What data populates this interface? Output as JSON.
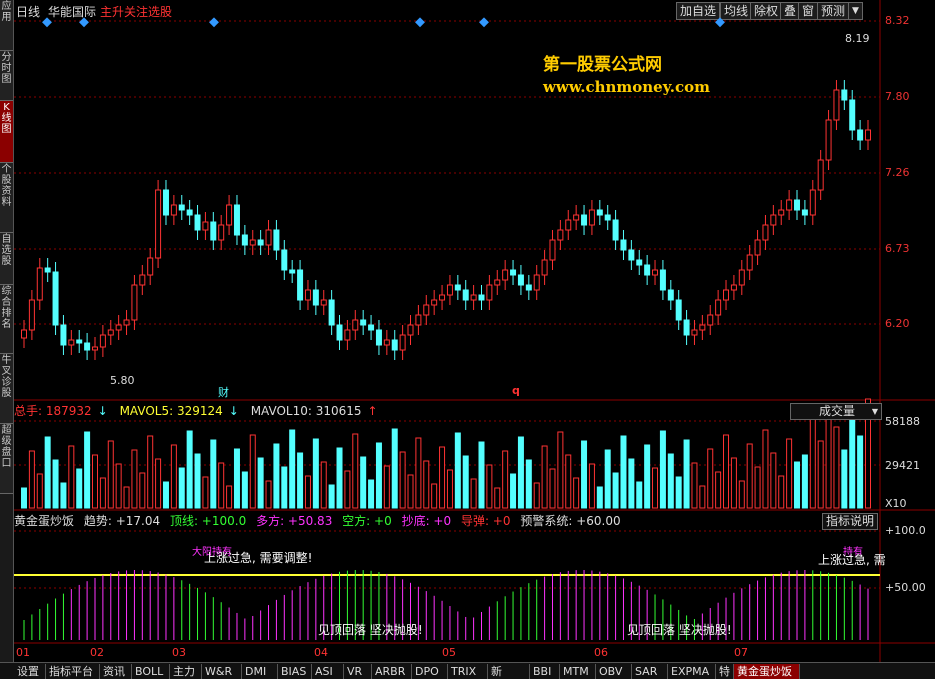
{
  "header": {
    "period": "日线",
    "stock_name": "华能国际",
    "formula_name": "主升关注选股",
    "buttons": [
      "加自选",
      "均线",
      "除权",
      "叠",
      "窗",
      "预测"
    ],
    "menu_arrow": "▼"
  },
  "sidebar": {
    "tabs": [
      "应用",
      "分时图",
      "K线图",
      "个股资料",
      "自选股",
      "综合排名",
      "牛叉诊股",
      "超级盘口"
    ]
  },
  "price_panel": {
    "y_ticks": [
      "8.32",
      "7.80",
      "7.26",
      "6.73",
      "6.20"
    ],
    "high_label": "8.19",
    "low_label": "5.80",
    "watermark_title": "第一股票公式网",
    "watermark_url": "www.chnmoney.com",
    "marker_cai": "财",
    "marker_q": "q"
  },
  "volume_panel": {
    "total_label": "总手: 187932",
    "mavol5_label": "MAVOL5: 329124",
    "mavol10_label": "MAVOL10: 310615",
    "selector": "成交量",
    "y_ticks": [
      "58188",
      "29421",
      "X10"
    ]
  },
  "indicator_panel": {
    "name": "黄金蛋炒饭",
    "trend": "趋势: +17.04",
    "top": "顶线: +100.0",
    "bull": "多方: +50.83",
    "bear": "空方: +0",
    "bottom": "抄底: +0",
    "missile": "导弹: +0",
    "warning": "预警系统: +60.00",
    "help_button": "指标说明",
    "y_ticks": [
      "+100.0",
      "+50.00"
    ],
    "note_overheat": "上涨过急, 需要调整!",
    "note_overheat_right": "上涨过急, 需",
    "note_peak": "见顶回落 坚决抛股!",
    "note_peak2": "见顶回落 坚决抛股!",
    "label_wait_left": "大阳持有",
    "label_wait_right": "持有"
  },
  "x_axis": {
    "labels": [
      "01",
      "02",
      "03",
      "04",
      "05",
      "06",
      "07"
    ]
  },
  "bottom_tabs": [
    "设置",
    "指标平台",
    "资讯",
    "BOLL",
    "主力",
    "W&R",
    "DMI",
    "BIAS",
    "ASI",
    "VR",
    "ARBR",
    "DPO",
    "TRIX",
    "新DMA",
    "BBI",
    "MTM",
    "OBV",
    "SAR",
    "EXPMA",
    "特",
    "黄金蛋炒饭"
  ],
  "colors": {
    "up": "#ff3333",
    "down": "#54ffff",
    "grid": "#8b0000",
    "yellow": "#ffff33",
    "magenta": "#ff33ff",
    "green": "#33ff33"
  }
}
